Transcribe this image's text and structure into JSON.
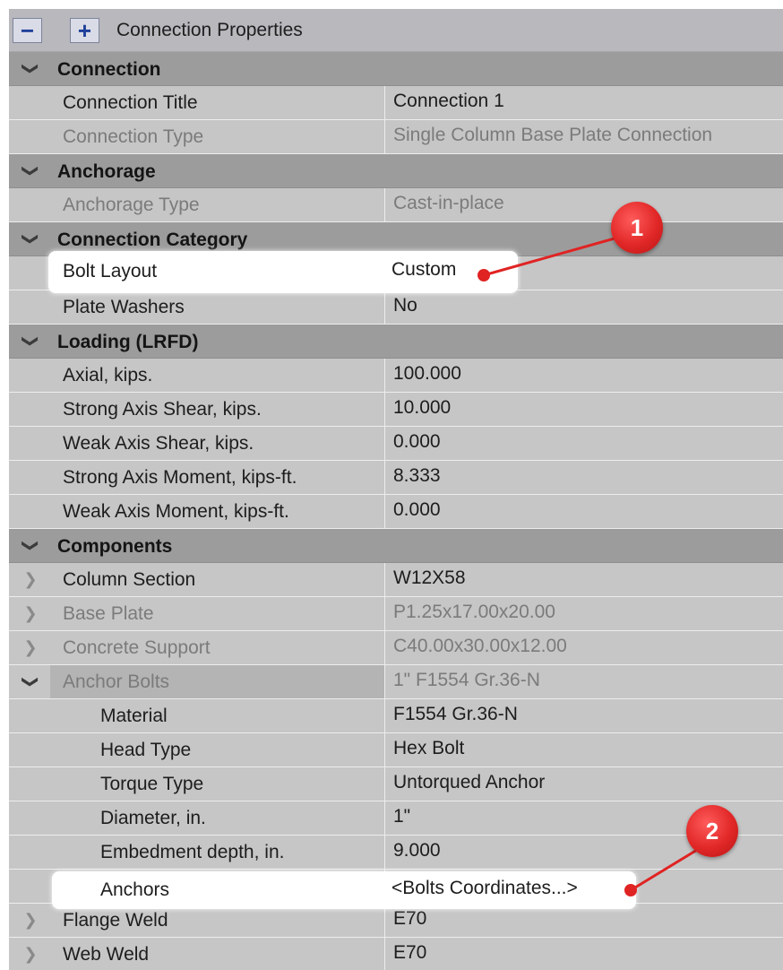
{
  "toolbar": {
    "collapse_glyph": "−",
    "expand_glyph": "+",
    "title": "Connection Properties"
  },
  "sections": {
    "connection": {
      "label": "Connection",
      "connection_title": {
        "name": "Connection Title",
        "value": "Connection 1"
      },
      "connection_type": {
        "name": "Connection Type",
        "value": "Single Column Base Plate Connection"
      }
    },
    "anchorage": {
      "label": "Anchorage",
      "anchorage_type": {
        "name": "Anchorage Type",
        "value": "Cast-in-place"
      }
    },
    "connection_category": {
      "label": "Connection Category",
      "bolt_layout": {
        "name": "Bolt Layout",
        "value": "Custom"
      },
      "plate_washers": {
        "name": "Plate Washers",
        "value": "No"
      }
    },
    "loading": {
      "label": "Loading (LRFD)",
      "axial": {
        "name": "Axial, kips.",
        "value": "100.000"
      },
      "strong_shear": {
        "name": "Strong Axis Shear, kips.",
        "value": "10.000"
      },
      "weak_shear": {
        "name": "Weak Axis Shear, kips.",
        "value": "0.000"
      },
      "strong_moment": {
        "name": "Strong Axis Moment, kips-ft.",
        "value": "8.333"
      },
      "weak_moment": {
        "name": "Weak Axis Moment, kips-ft.",
        "value": "0.000"
      }
    },
    "components": {
      "label": "Components",
      "column_section": {
        "name": "Column Section",
        "value": "W12X58"
      },
      "base_plate": {
        "name": "Base Plate",
        "value": "P1.25x17.00x20.00"
      },
      "concrete_support": {
        "name": "Concrete Support",
        "value": "C40.00x30.00x12.00"
      },
      "anchor_bolts": {
        "name": "Anchor Bolts",
        "value": "1\" F1554 Gr.36-N",
        "material": {
          "name": "Material",
          "value": "F1554 Gr.36-N"
        },
        "head_type": {
          "name": "Head Type",
          "value": "Hex Bolt"
        },
        "torque_type": {
          "name": "Torque Type",
          "value": "Untorqued Anchor"
        },
        "diameter": {
          "name": "Diameter, in.",
          "value": "1\""
        },
        "embedment": {
          "name": "Embedment depth, in.",
          "value": "9.000"
        },
        "anchors": {
          "name": "Anchors",
          "value": "<Bolts Coordinates...>"
        }
      },
      "flange_weld": {
        "name": "Flange Weld",
        "value": "E70"
      },
      "web_weld": {
        "name": "Web Weld",
        "value": "E70"
      }
    }
  },
  "icons": {
    "expanded": "❯",
    "collapsed": "❯"
  },
  "callouts": {
    "one": "1",
    "two": "2"
  },
  "colors": {
    "accent": "#e12727",
    "category_bg": "#9c9c9c",
    "row_bg": "#c6c6c6",
    "highlight": "#ffffff"
  }
}
